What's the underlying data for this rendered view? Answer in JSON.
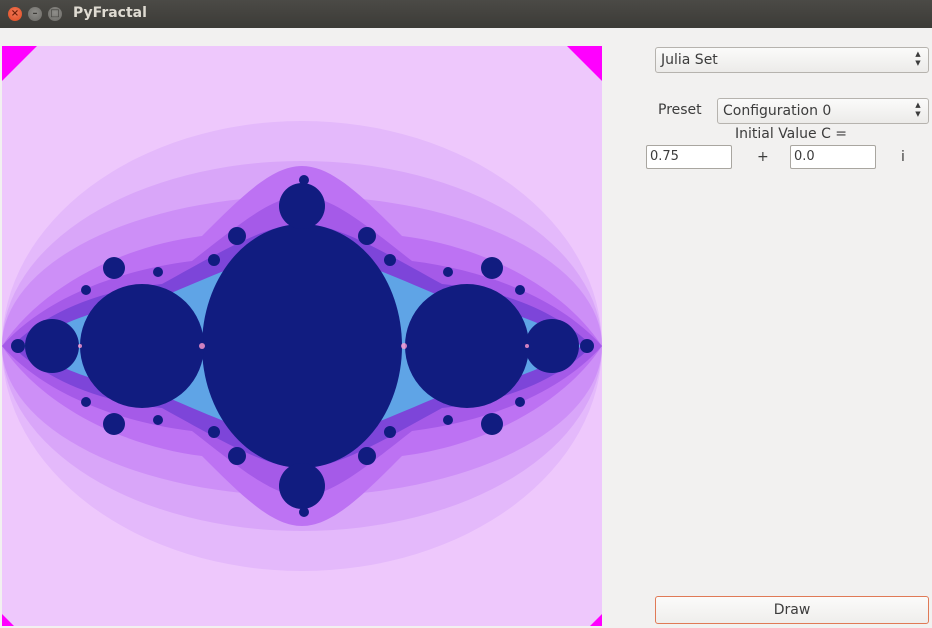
{
  "window": {
    "title": "PyFractal"
  },
  "fractal_type": {
    "selected": "Julia Set"
  },
  "preset": {
    "label": "Preset",
    "selected": "Configuration 0"
  },
  "initial_value": {
    "label": "Initial Value C =",
    "real": "0.75",
    "plus": "+",
    "imag": "0.0",
    "imag_unit": "i"
  },
  "draw_button": {
    "label": "Draw"
  },
  "colors": {
    "set_fill": "#111c80",
    "bg_light": "#eec8fc",
    "corner_magenta": "#ff00ff",
    "accent_border": "#e07a56"
  },
  "icons": {
    "close": "close-icon",
    "minimize": "minimize-icon",
    "maximize": "maximize-icon",
    "updown": "updown-arrows-icon"
  }
}
